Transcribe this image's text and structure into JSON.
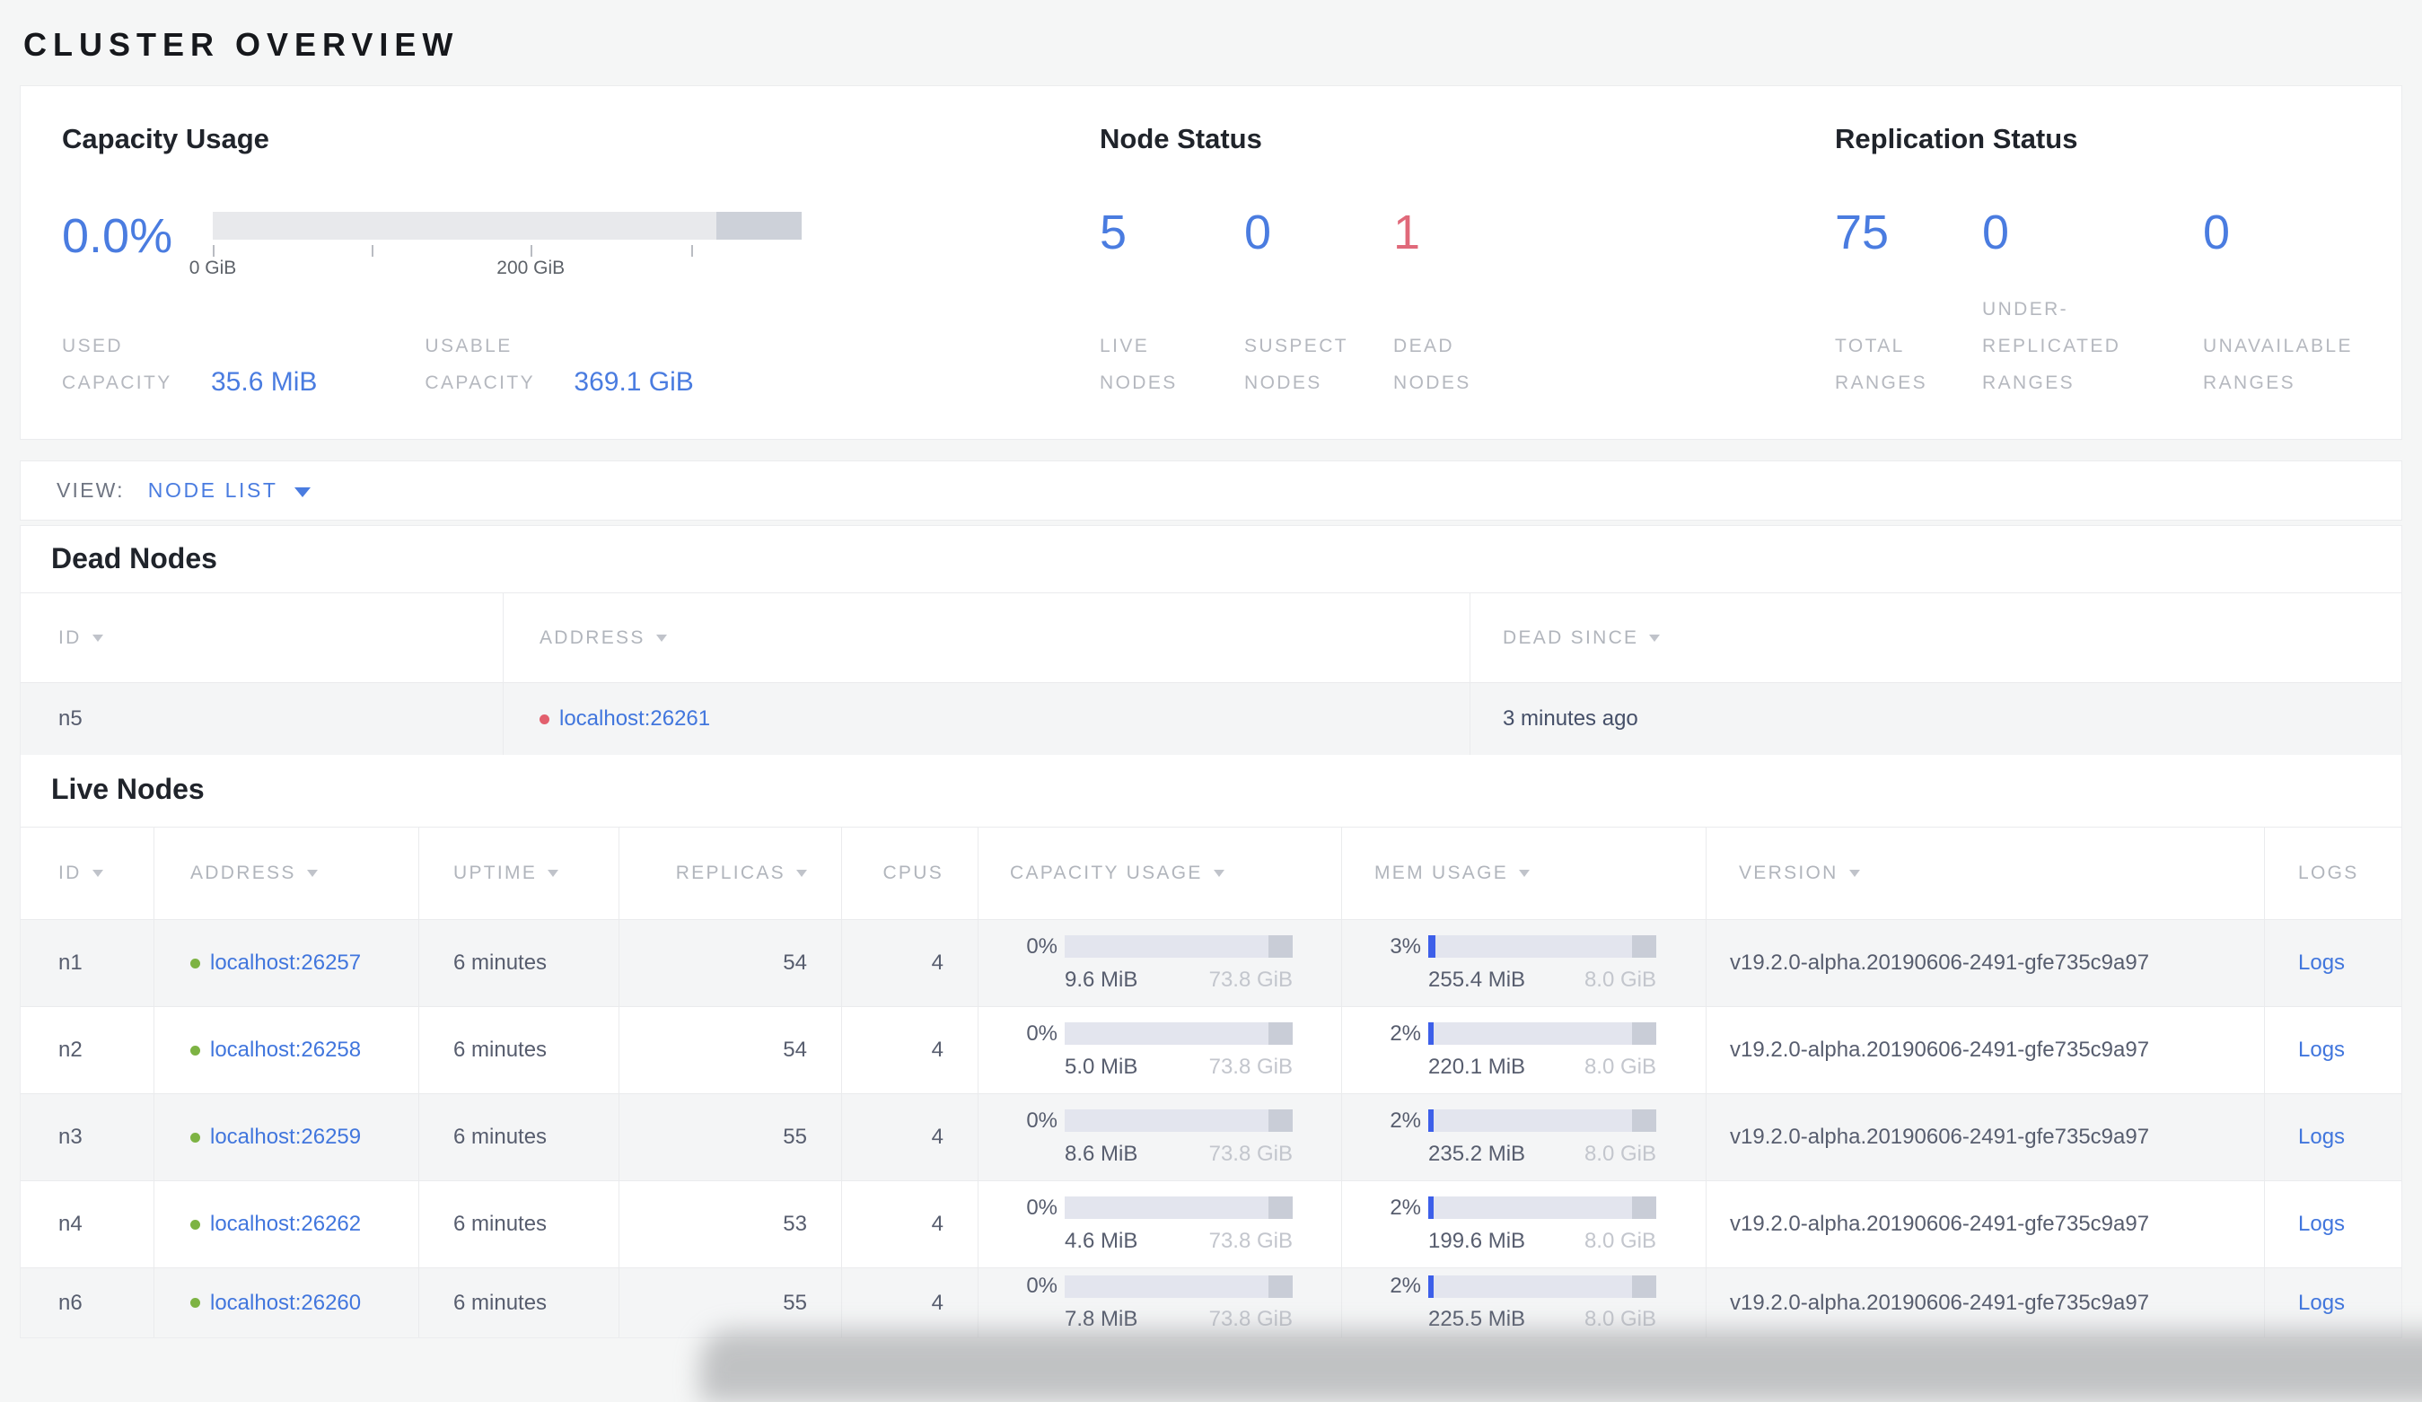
{
  "colors": {
    "blue": "#4a7ce0",
    "link_blue": "#4176dd",
    "red": "#e0697a",
    "green_dot": "#7db343",
    "red_dot": "#e25f6d",
    "bar_track": "#e3e5ee",
    "bar_fill_blue": "#3d5fe9",
    "bar_cap_dark": "#c9cdd7"
  },
  "page_title": "CLUSTER OVERVIEW",
  "summary": {
    "capacity": {
      "title": "Capacity Usage",
      "percent": "0.0%",
      "tick_labels": [
        "0 GiB",
        "200 GiB"
      ],
      "stats": [
        {
          "lines": [
            "USED",
            "CAPACITY"
          ],
          "value": "35.6 MiB"
        },
        {
          "lines": [
            "USABLE",
            "CAPACITY"
          ],
          "value": "369.1 GiB"
        }
      ]
    },
    "node_status": {
      "title": "Node Status",
      "stats": [
        {
          "value": "5",
          "lines": [
            "LIVE",
            "NODES"
          ]
        },
        {
          "value": "0",
          "lines": [
            "SUSPECT",
            "NODES"
          ]
        },
        {
          "value": "1",
          "lines": [
            "DEAD",
            "NODES"
          ]
        }
      ]
    },
    "replication": {
      "title": "Replication Status",
      "stats": [
        {
          "value": "75",
          "lines": [
            "TOTAL",
            "RANGES"
          ]
        },
        {
          "value": "0",
          "lines": [
            "UNDER-",
            "REPLICATED",
            "RANGES"
          ]
        },
        {
          "value": "0",
          "lines": [
            "UNAVAILABLE",
            "RANGES"
          ]
        }
      ]
    }
  },
  "view_bar": {
    "label": "VIEW:",
    "value": "NODE LIST"
  },
  "dead_section": {
    "title": "Dead Nodes",
    "headers": [
      "ID",
      "ADDRESS",
      "DEAD SINCE"
    ],
    "rows": [
      {
        "id": "n5",
        "address": "localhost:26261",
        "dead_since": "3 minutes ago"
      }
    ]
  },
  "live_section": {
    "title": "Live Nodes",
    "headers": [
      "ID",
      "ADDRESS",
      "UPTIME",
      "REPLICAS",
      "CPUS",
      "CAPACITY USAGE",
      "MEM USAGE",
      "VERSION",
      "LOGS"
    ],
    "rows": [
      {
        "id": "n1",
        "address": "localhost:26257",
        "uptime": "6 minutes",
        "replicas": "54",
        "cpus": "4",
        "capacity": {
          "pct": "0%",
          "used": "9.6 MiB",
          "total": "73.8 GiB",
          "fill_pct": 0
        },
        "mem": {
          "pct": "3%",
          "used": "255.4 MiB",
          "total": "8.0 GiB",
          "fill_pct": 3
        },
        "version": "v19.2.0-alpha.20190606-2491-gfe735c9a97",
        "logs_label": "Logs"
      },
      {
        "id": "n2",
        "address": "localhost:26258",
        "uptime": "6 minutes",
        "replicas": "54",
        "cpus": "4",
        "capacity": {
          "pct": "0%",
          "used": "5.0 MiB",
          "total": "73.8 GiB",
          "fill_pct": 0
        },
        "mem": {
          "pct": "2%",
          "used": "220.1 MiB",
          "total": "8.0 GiB",
          "fill_pct": 2.5
        },
        "version": "v19.2.0-alpha.20190606-2491-gfe735c9a97",
        "logs_label": "Logs"
      },
      {
        "id": "n3",
        "address": "localhost:26259",
        "uptime": "6 minutes",
        "replicas": "55",
        "cpus": "4",
        "capacity": {
          "pct": "0%",
          "used": "8.6 MiB",
          "total": "73.8 GiB",
          "fill_pct": 0
        },
        "mem": {
          "pct": "2%",
          "used": "235.2 MiB",
          "total": "8.0 GiB",
          "fill_pct": 2.5
        },
        "version": "v19.2.0-alpha.20190606-2491-gfe735c9a97",
        "logs_label": "Logs"
      },
      {
        "id": "n4",
        "address": "localhost:26262",
        "uptime": "6 minutes",
        "replicas": "53",
        "cpus": "4",
        "capacity": {
          "pct": "0%",
          "used": "4.6 MiB",
          "total": "73.8 GiB",
          "fill_pct": 0
        },
        "mem": {
          "pct": "2%",
          "used": "199.6 MiB",
          "total": "8.0 GiB",
          "fill_pct": 2.5
        },
        "version": "v19.2.0-alpha.20190606-2491-gfe735c9a97",
        "logs_label": "Logs"
      },
      {
        "id": "n6",
        "address": "localhost:26260",
        "uptime": "6 minutes",
        "replicas": "55",
        "cpus": "4",
        "capacity": {
          "pct": "0%",
          "used": "7.8 MiB",
          "total": "73.8 GiB",
          "fill_pct": 0
        },
        "mem": {
          "pct": "2%",
          "used": "225.5 MiB",
          "total": "8.0 GiB",
          "fill_pct": 2.5
        },
        "version": "v19.2.0-alpha.20190606-2491-gfe735c9a97",
        "logs_label": "Logs"
      }
    ]
  }
}
